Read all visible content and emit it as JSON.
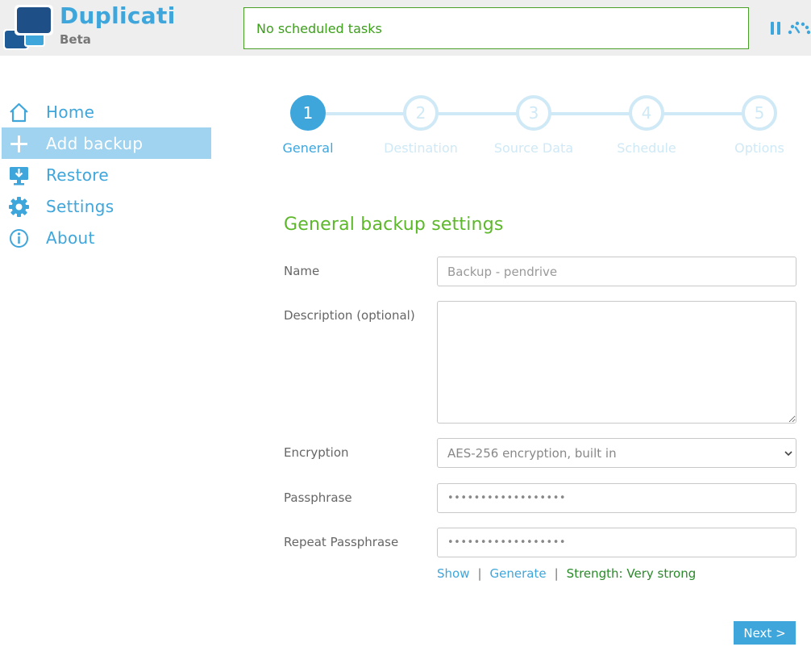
{
  "brand": {
    "title": "Duplicati",
    "subtitle": "Beta"
  },
  "status": {
    "text": "No scheduled tasks"
  },
  "toolbar": {
    "pause_icon": "pause-icon",
    "throttle_icon": "throttle-icon"
  },
  "sidebar": {
    "items": [
      {
        "label": "Home",
        "icon": "home-icon",
        "active": false
      },
      {
        "label": "Add backup",
        "icon": "plus-icon",
        "active": true
      },
      {
        "label": "Restore",
        "icon": "restore-icon",
        "active": false
      },
      {
        "label": "Settings",
        "icon": "gear-icon",
        "active": false
      },
      {
        "label": "About",
        "icon": "info-icon",
        "active": false
      }
    ]
  },
  "steps": [
    {
      "number": "1",
      "label": "General",
      "active": true
    },
    {
      "number": "2",
      "label": "Destination",
      "active": false
    },
    {
      "number": "3",
      "label": "Source Data",
      "active": false
    },
    {
      "number": "4",
      "label": "Schedule",
      "active": false
    },
    {
      "number": "5",
      "label": "Options",
      "active": false
    }
  ],
  "form": {
    "section_title": "General backup settings",
    "name": {
      "label": "Name",
      "value": "Backup - pendrive"
    },
    "description": {
      "label": "Description (optional)",
      "value": ""
    },
    "encryption": {
      "label": "Encryption",
      "value": "AES-256 encryption, built in"
    },
    "passphrase": {
      "label": "Passphrase",
      "masked": "••••••••••••••••••"
    },
    "repeat_passphrase": {
      "label": "Repeat Passphrase",
      "masked": "••••••••••••••••••"
    },
    "pw_actions": {
      "show": "Show",
      "separator": "|",
      "generate": "Generate",
      "strength": "Strength: Very strong"
    },
    "next_label": "Next >"
  },
  "colors": {
    "accent": "#3fa6dc",
    "active_nav_bg": "#9fd3ef",
    "title_green": "#5cb82a",
    "status_green": "#3d9e1c",
    "step_inactive": "#cfe9f6",
    "header_bg": "#eeeeee"
  }
}
